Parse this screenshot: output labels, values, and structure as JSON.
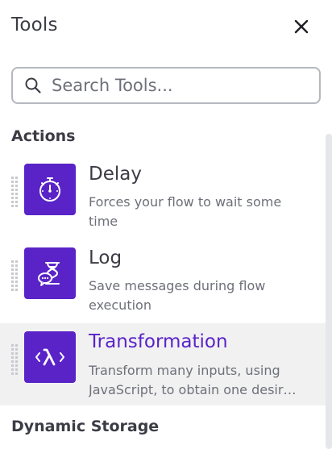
{
  "panel": {
    "title": "Tools",
    "close_icon": "close-icon"
  },
  "search": {
    "placeholder": "Search Tools...",
    "value": "",
    "icon": "search-icon"
  },
  "sections": [
    {
      "label": "Actions",
      "tools": [
        {
          "name": "Delay",
          "description": "Forces your flow to wait some time",
          "icon": "stopwatch-icon",
          "active": false
        },
        {
          "name": "Log",
          "description": "Save messages during flow execution",
          "icon": "log-hourglass-icon",
          "active": false
        },
        {
          "name": "Transformation",
          "description": "Transform many inputs, using JavaScript, to obtain one desir…",
          "icon": "lambda-icon",
          "active": true
        }
      ]
    },
    {
      "label": "Dynamic Storage",
      "tools": []
    }
  ],
  "colors": {
    "accent": "#5a23c8",
    "text": "#3c3c46",
    "muted": "#6e7079",
    "active_row": "#f1f1f2",
    "scroll_track": "#e6e7ea"
  }
}
